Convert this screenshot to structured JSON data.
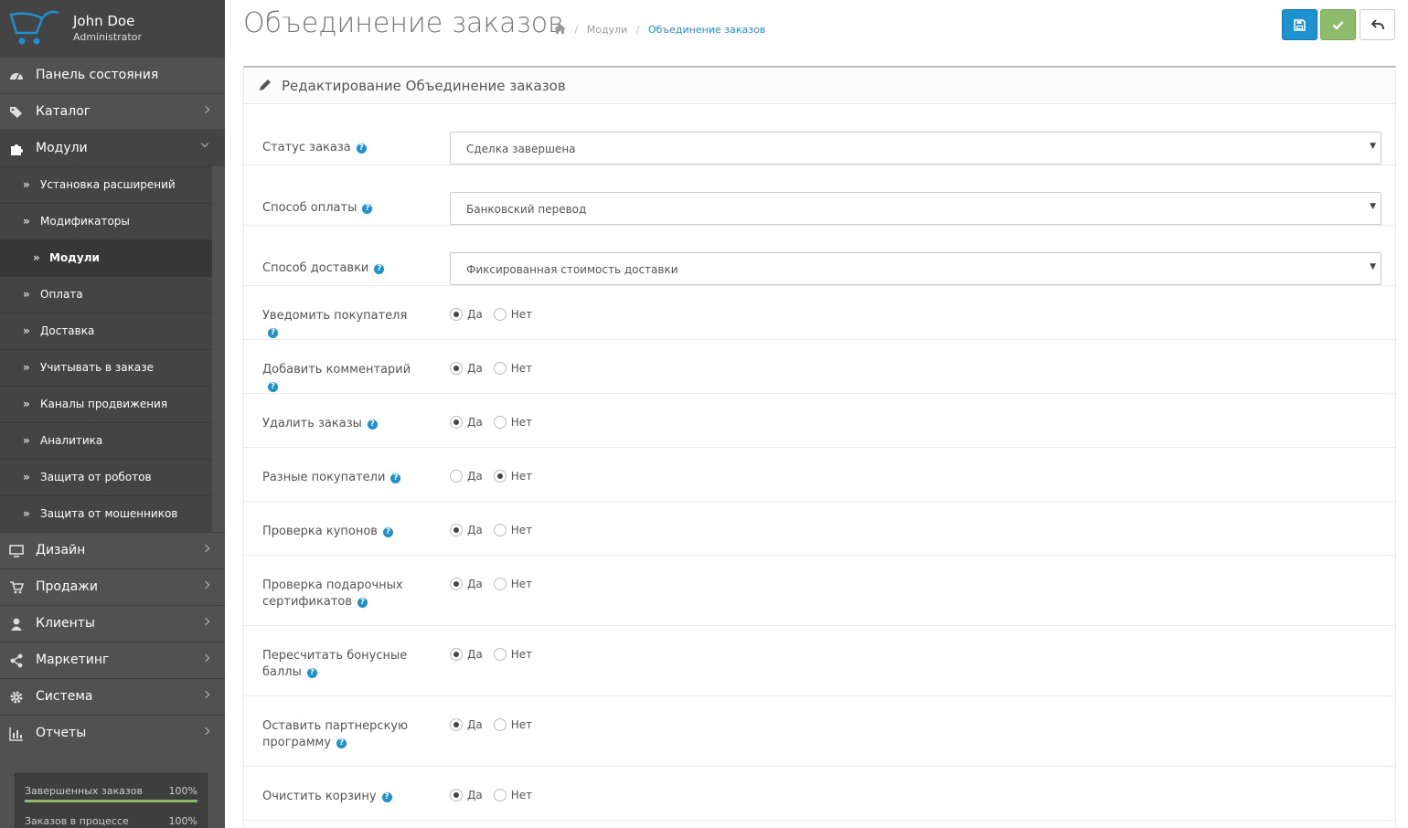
{
  "user": {
    "name": "John Doe",
    "role": "Administrator"
  },
  "colors": {
    "sidebar": "#515151",
    "primary": "#1e91cf",
    "success": "#8fbb6c"
  },
  "nav": [
    {
      "label": "Панель состояния",
      "icon": "dashboard-icon"
    },
    {
      "label": "Каталог",
      "icon": "tags-icon"
    },
    {
      "label": "Модули",
      "icon": "puzzle-icon"
    },
    {
      "label": "Дизайн",
      "icon": "desktop-icon"
    },
    {
      "label": "Продажи",
      "icon": "cart-icon"
    },
    {
      "label": "Клиенты",
      "icon": "user-icon"
    },
    {
      "label": "Маркетинг",
      "icon": "share-icon"
    },
    {
      "label": "Система",
      "icon": "gear-icon"
    },
    {
      "label": "Отчеты",
      "icon": "bar-chart-icon"
    }
  ],
  "subnav": [
    "Установка расширений",
    "Модификаторы",
    "Модули",
    "Оплата",
    "Доставка",
    "Учитывать в заказе",
    "Каналы продвижения",
    "Аналитика",
    "Защита от роботов",
    "Защита от мошенников"
  ],
  "stats": [
    {
      "label": "Завершенных заказов",
      "percent": "100%",
      "value": 1.0
    },
    {
      "label": "Заказов в процессе",
      "percent": "100%",
      "value": 1.0
    }
  ],
  "page": {
    "title": "Объединение заказов",
    "breadcrumb": [
      "Модули",
      "Объединение заказов"
    ],
    "panel_title": "Редактирование Объединение заказов"
  },
  "form": {
    "selects": [
      {
        "label": "Статус заказа",
        "value": "Сделка завершена"
      },
      {
        "label": "Способ оплаты",
        "value": "Банковский перевод"
      },
      {
        "label": "Способ доставки",
        "value": "Фиксированная стоимость доставки"
      }
    ],
    "yes": "Да",
    "no": "Нет",
    "radios": [
      {
        "label": "Уведомить покупателя",
        "selected": "yes"
      },
      {
        "label": "Добавить комментарий",
        "selected": "yes"
      },
      {
        "label": "Удалить заказы",
        "selected": "yes"
      },
      {
        "label": "Разные покупатели",
        "selected": "no"
      },
      {
        "label": "Проверка купонов",
        "selected": "yes"
      },
      {
        "label": "Проверка подарочных сертификатов",
        "selected": "yes"
      },
      {
        "label": "Пересчитать бонусные баллы",
        "selected": "yes"
      },
      {
        "label": "Оставить партнерскую программу",
        "selected": "yes"
      },
      {
        "label": "Очистить корзину",
        "selected": "yes"
      }
    ]
  }
}
